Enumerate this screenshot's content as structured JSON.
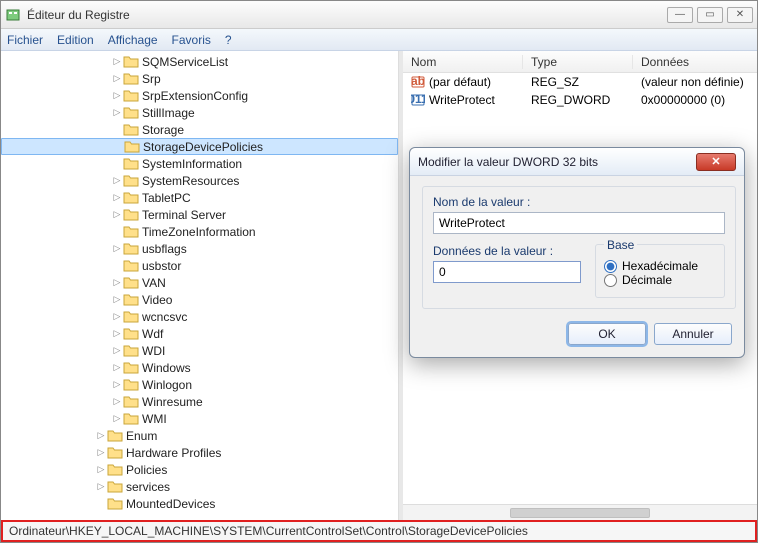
{
  "window": {
    "title": "Éditeur du Registre"
  },
  "menu": {
    "items": [
      "Fichier",
      "Edition",
      "Affichage",
      "Favoris",
      "?"
    ]
  },
  "tree": {
    "indentBase": 110,
    "selected": "StorageDevicePolicies",
    "items": [
      {
        "label": "SQMServiceList",
        "exp": true
      },
      {
        "label": "Srp",
        "exp": true
      },
      {
        "label": "SrpExtensionConfig",
        "exp": true
      },
      {
        "label": "StillImage",
        "exp": true
      },
      {
        "label": "Storage"
      },
      {
        "label": "StorageDevicePolicies"
      },
      {
        "label": "SystemInformation"
      },
      {
        "label": "SystemResources",
        "exp": true
      },
      {
        "label": "TabletPC",
        "exp": true
      },
      {
        "label": "Terminal Server",
        "exp": true
      },
      {
        "label": "TimeZoneInformation"
      },
      {
        "label": "usbflags",
        "exp": true
      },
      {
        "label": "usbstor"
      },
      {
        "label": "VAN",
        "exp": true
      },
      {
        "label": "Video",
        "exp": true
      },
      {
        "label": "wcncsvc",
        "exp": true
      },
      {
        "label": "Wdf",
        "exp": true
      },
      {
        "label": "WDI",
        "exp": true
      },
      {
        "label": "Windows",
        "exp": true
      },
      {
        "label": "Winlogon",
        "exp": true
      },
      {
        "label": "Winresume",
        "exp": true
      },
      {
        "label": "WMI",
        "exp": true
      }
    ],
    "outerItems": [
      {
        "label": "Enum",
        "exp": true
      },
      {
        "label": "Hardware Profiles",
        "exp": true
      },
      {
        "label": "Policies",
        "exp": true
      },
      {
        "label": "services",
        "exp": true
      },
      {
        "label": "MountedDevices"
      }
    ],
    "outerIndent": 94
  },
  "values": {
    "headers": {
      "name": "Nom",
      "type": "Type",
      "data": "Données"
    },
    "rows": [
      {
        "icon": "sz",
        "name": "(par défaut)",
        "type": "REG_SZ",
        "data": "(valeur non définie)"
      },
      {
        "icon": "bin",
        "name": "WriteProtect",
        "type": "REG_DWORD",
        "data": "0x00000000 (0)"
      }
    ]
  },
  "dialog": {
    "title": "Modifier la valeur DWORD 32 bits",
    "nameLabel": "Nom de la valeur :",
    "nameValue": "WriteProtect",
    "dataLabel": "Données de la valeur :",
    "dataValue": "0",
    "baseLabel": "Base",
    "hexLabel": "Hexadécimale",
    "decLabel": "Décimale",
    "ok": "OK",
    "cancel": "Annuler"
  },
  "status": {
    "path": "Ordinateur\\HKEY_LOCAL_MACHINE\\SYSTEM\\CurrentControlSet\\Control\\StorageDevicePolicies"
  }
}
